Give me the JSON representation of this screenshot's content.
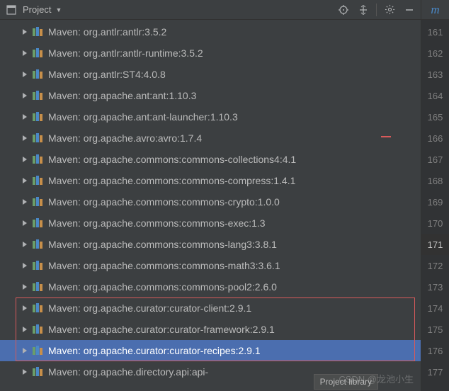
{
  "header": {
    "title": "Project",
    "maven_letter": "m"
  },
  "gutter": {
    "start": 161,
    "current": 171,
    "count": 17
  },
  "tree": {
    "items": [
      {
        "label": "Maven: org.antlr:antlr:3.5.2"
      },
      {
        "label": "Maven: org.antlr:antlr-runtime:3.5.2"
      },
      {
        "label": "Maven: org.antlr:ST4:4.0.8"
      },
      {
        "label": "Maven: org.apache.ant:ant:1.10.3"
      },
      {
        "label": "Maven: org.apache.ant:ant-launcher:1.10.3"
      },
      {
        "label": "Maven: org.apache.avro:avro:1.7.4"
      },
      {
        "label": "Maven: org.apache.commons:commons-collections4:4.1"
      },
      {
        "label": "Maven: org.apache.commons:commons-compress:1.4.1"
      },
      {
        "label": "Maven: org.apache.commons:commons-crypto:1.0.0"
      },
      {
        "label": "Maven: org.apache.commons:commons-exec:1.3"
      },
      {
        "label": "Maven: org.apache.commons:commons-lang3:3.8.1"
      },
      {
        "label": "Maven: org.apache.commons:commons-math3:3.6.1"
      },
      {
        "label": "Maven: org.apache.commons:commons-pool2:2.6.0"
      },
      {
        "label": "Maven: org.apache.curator:curator-client:2.9.1"
      },
      {
        "label": "Maven: org.apache.curator:curator-framework:2.9.1"
      },
      {
        "label": "Maven: org.apache.curator:curator-recipes:2.9.1",
        "selected": true
      },
      {
        "label": "Maven: org.apache.directory.api:api-"
      }
    ]
  },
  "highlight": {
    "first": 13,
    "last": 15
  },
  "tooltip": "Project library",
  "watermark": "CSDN @龙池小生"
}
